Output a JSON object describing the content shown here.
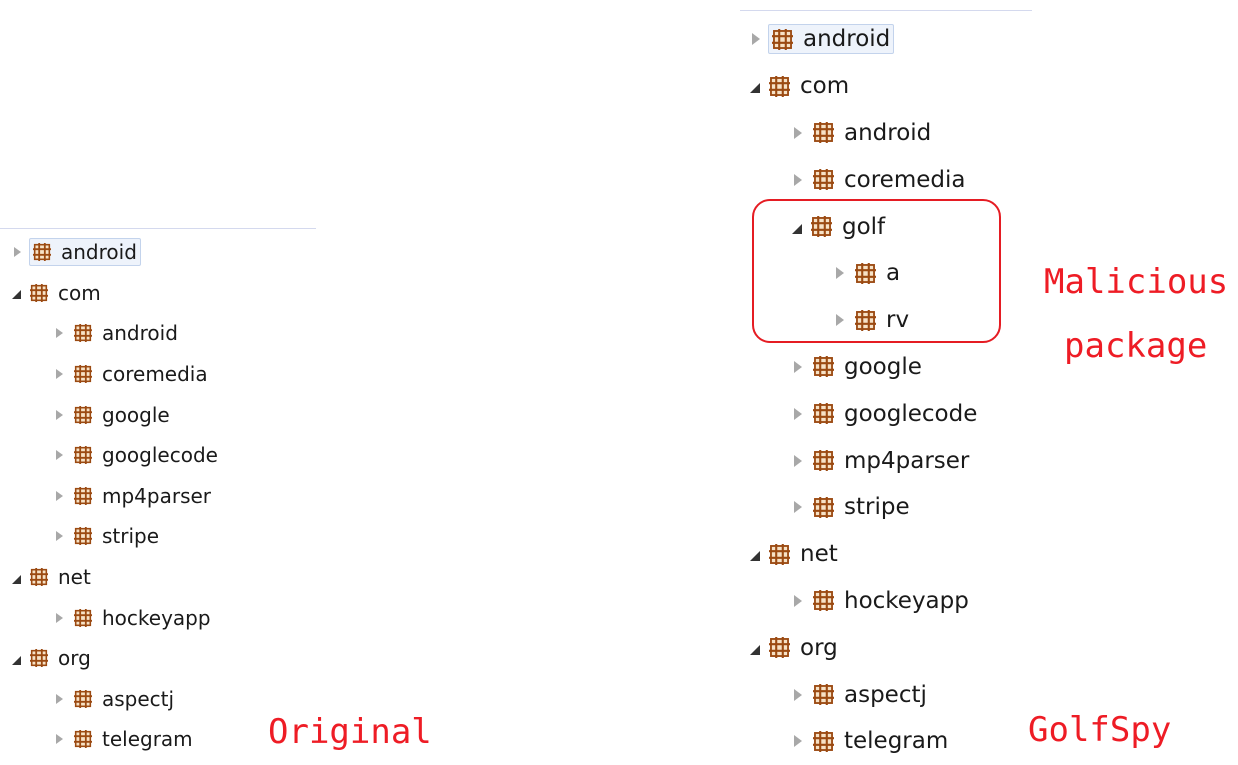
{
  "icon_color": "#9b4a12",
  "annotation_color": "#ee1c25",
  "left_tree": {
    "caption": "Original",
    "nodes": [
      {
        "label": "android",
        "depth": 0,
        "state": "collapsed",
        "selected": true
      },
      {
        "label": "com",
        "depth": 0,
        "state": "expanded",
        "selected": false
      },
      {
        "label": "android",
        "depth": 1,
        "state": "collapsed",
        "selected": false
      },
      {
        "label": "coremedia",
        "depth": 1,
        "state": "collapsed",
        "selected": false
      },
      {
        "label": "google",
        "depth": 1,
        "state": "collapsed",
        "selected": false
      },
      {
        "label": "googlecode",
        "depth": 1,
        "state": "collapsed",
        "selected": false
      },
      {
        "label": "mp4parser",
        "depth": 1,
        "state": "collapsed",
        "selected": false
      },
      {
        "label": "stripe",
        "depth": 1,
        "state": "collapsed",
        "selected": false
      },
      {
        "label": "net",
        "depth": 0,
        "state": "expanded",
        "selected": false
      },
      {
        "label": "hockeyapp",
        "depth": 1,
        "state": "collapsed",
        "selected": false
      },
      {
        "label": "org",
        "depth": 0,
        "state": "expanded",
        "selected": false
      },
      {
        "label": "aspectj",
        "depth": 1,
        "state": "collapsed",
        "selected": false
      },
      {
        "label": "telegram",
        "depth": 1,
        "state": "collapsed",
        "selected": false
      }
    ]
  },
  "right_tree": {
    "caption": "GolfSpy",
    "annotation": [
      "Malicious",
      "package"
    ],
    "nodes": [
      {
        "label": "android",
        "depth": 0,
        "state": "collapsed",
        "selected": true
      },
      {
        "label": "com",
        "depth": 0,
        "state": "expanded",
        "selected": false
      },
      {
        "label": "android",
        "depth": 1,
        "state": "collapsed",
        "selected": false
      },
      {
        "label": "coremedia",
        "depth": 1,
        "state": "collapsed",
        "selected": false
      },
      {
        "label": "golf",
        "depth": 1,
        "state": "expanded",
        "selected": false
      },
      {
        "label": "a",
        "depth": 2,
        "state": "collapsed",
        "selected": false
      },
      {
        "label": "rv",
        "depth": 2,
        "state": "collapsed",
        "selected": false
      },
      {
        "label": "google",
        "depth": 1,
        "state": "collapsed",
        "selected": false
      },
      {
        "label": "googlecode",
        "depth": 1,
        "state": "collapsed",
        "selected": false
      },
      {
        "label": "mp4parser",
        "depth": 1,
        "state": "collapsed",
        "selected": false
      },
      {
        "label": "stripe",
        "depth": 1,
        "state": "collapsed",
        "selected": false
      },
      {
        "label": "net",
        "depth": 0,
        "state": "expanded",
        "selected": false
      },
      {
        "label": "hockeyapp",
        "depth": 1,
        "state": "collapsed",
        "selected": false
      },
      {
        "label": "org",
        "depth": 0,
        "state": "expanded",
        "selected": false
      },
      {
        "label": "aspectj",
        "depth": 1,
        "state": "collapsed",
        "selected": false
      },
      {
        "label": "telegram",
        "depth": 1,
        "state": "collapsed",
        "selected": false
      }
    ]
  }
}
